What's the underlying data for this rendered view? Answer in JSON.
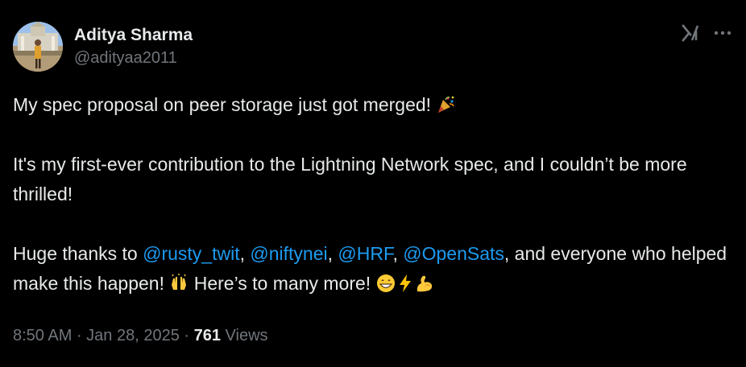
{
  "author": {
    "display_name": "Aditya Sharma",
    "handle": "@adityaa2011",
    "avatar_icon": "user-avatar"
  },
  "tweet": {
    "line1_text": "My spec proposal on peer storage just got merged! ",
    "line1_emoji": "party-popper-icon",
    "para2": "It's my first-ever contribution to the Lightning Network spec, and I couldn’t be more thrilled!",
    "para3_prefix": "Huge thanks to ",
    "mentions": [
      "@rusty_twit",
      "@niftynei",
      "@HRF",
      "@OpenSats"
    ],
    "sep": ", ",
    "para3_suffix": ", and everyone who helped make this happen! ",
    "para3_after_hands": " Here’s to many more! ",
    "emojis": [
      "raised-hands-icon",
      "grinning-face-icon",
      "lightning-bolt-icon",
      "flexed-biceps-icon"
    ]
  },
  "meta": {
    "time": "8:50 AM",
    "dot1": " · ",
    "date": "Jan 28, 2025",
    "dot2": " · ",
    "views_count": "761",
    "views_label": " Views"
  },
  "actions": {
    "grok_icon": "grok-icon",
    "more_icon": "more-icon"
  },
  "colors": {
    "background": "#000000",
    "text": "#e7e9ea",
    "muted": "#71767b",
    "link": "#1d9bf0"
  }
}
